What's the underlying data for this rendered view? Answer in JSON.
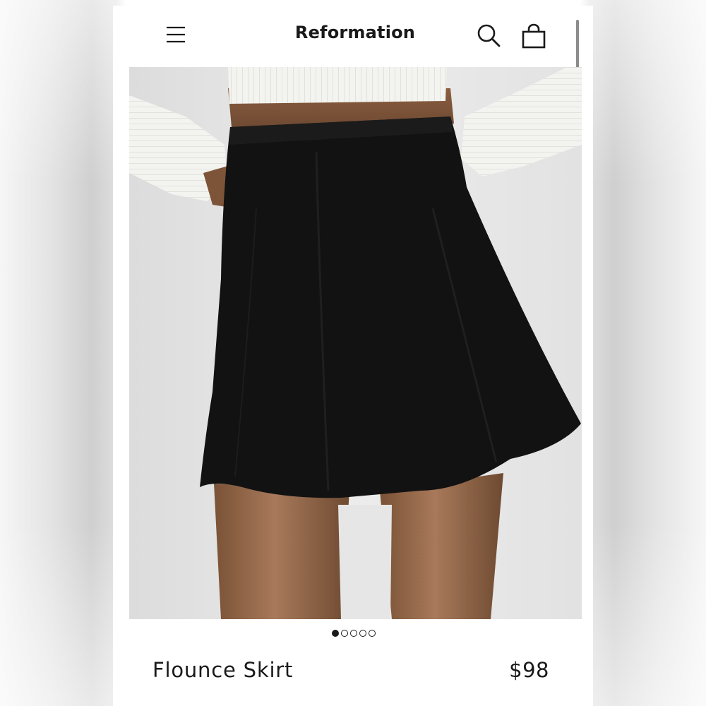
{
  "header": {
    "brand": "Reformation",
    "icons": {
      "menu": "hamburger-menu-icon",
      "search": "search-icon",
      "cart": "shopping-bag-icon"
    }
  },
  "carousel": {
    "total_images": 5,
    "active_index": 0
  },
  "product": {
    "name": "Flounce Skirt",
    "price": "$98"
  },
  "colors": {
    "text": "#1a1a1a",
    "background": "#ffffff",
    "skirt": "#111111",
    "top": "#f2f2ef"
  }
}
